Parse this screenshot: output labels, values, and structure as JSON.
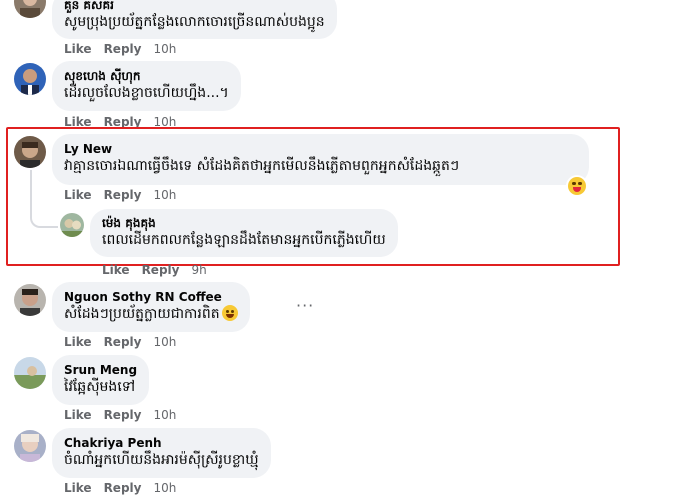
{
  "comments": [
    {
      "author": "គួន គសគរ",
      "text": "សូមប្រុងប្រយ័ត្នកន្លែងលោកចោរច្រើនណាស់បងប្អូន",
      "like": "Like",
      "reply": "Reply",
      "time": "10h"
    },
    {
      "author": "សុខហេង ស៊ីហុក",
      "text": "ដើរលួចលែងខ្លាចហើយហ្នឹង...។",
      "like": "Like",
      "reply": "Reply",
      "time": "10h"
    },
    {
      "author": "Ly New",
      "text": "វាគ្មានចោរឯណាធ្វើចឹងទេ សំដែងគិតថាអ្នកមើលនឹងភ្លើតាមពួកអ្នកសំដែងឆ្កួតៗ",
      "like": "Like",
      "reply": "Reply",
      "time": "10h"
    },
    {
      "author": "ម៉េង គុងគុង",
      "text": "ពេលដើមកពលកន្លែងឡានដឹងតែមានអ្នកបើកភ្លើងហើយ",
      "like": "Like",
      "reply": "Reply",
      "time": "9h"
    },
    {
      "author": "Nguon Sothy RN Coffee",
      "text": "សំដែងៗប្រយ័ត្នក្លាយជាការពិត",
      "like": "Like",
      "reply": "Reply",
      "time": "10h",
      "more": "···"
    },
    {
      "author": "Srun Meng",
      "text": "វៃឆ្អែសុីមងទៅ",
      "like": "Like",
      "reply": "Reply",
      "time": "10h"
    },
    {
      "author": "Chakriya Penh",
      "text": "ចំណាំអ្នកហើយនឹងអារម៉ស៊ីស្រីរូបខ្លាឃ្មុំ",
      "like": "Like",
      "reply": "Reply",
      "time": "10h"
    }
  ],
  "colors": {
    "bubble": "#f0f2f5",
    "highlight": "#e02020",
    "meta": "#65676b"
  },
  "icons": [
    "laughing-emoji-icon",
    "grinning-squinting-emoji-icon",
    "more-options-icon"
  ]
}
